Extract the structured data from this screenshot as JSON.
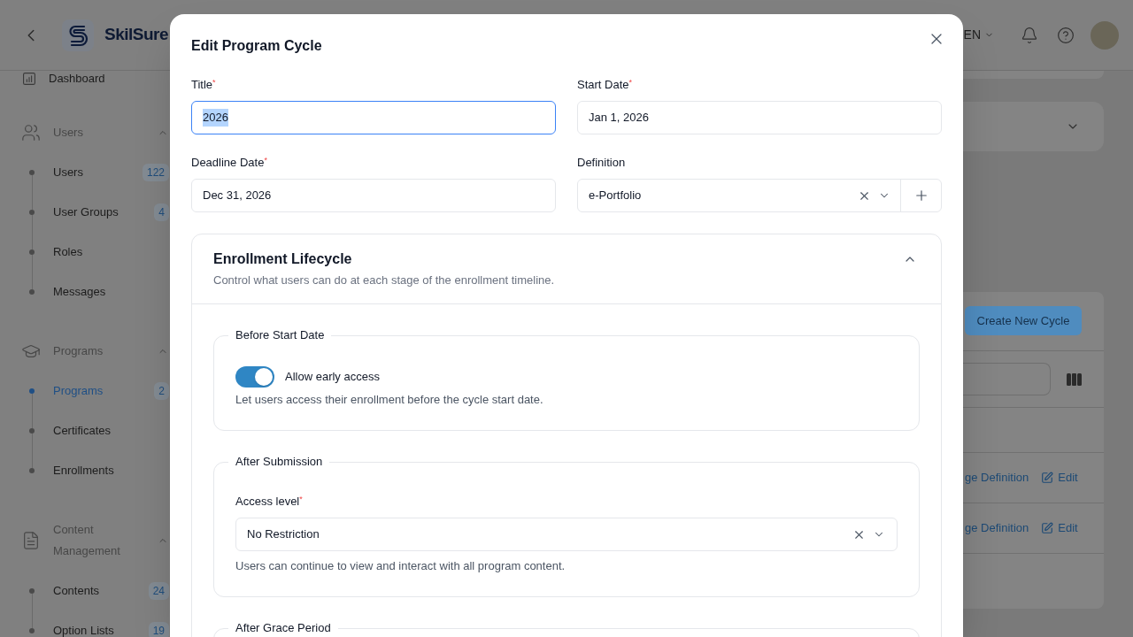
{
  "header": {
    "logo_text": "SkilSure",
    "language": "EN"
  },
  "sidebar": {
    "items": [
      {
        "kind": "link",
        "label": "Dashboard",
        "selected": false
      },
      {
        "kind": "group",
        "label": "Users",
        "expanded": true,
        "children": [
          {
            "label": "Users",
            "count": "122",
            "selected": false
          },
          {
            "label": "User Groups",
            "count": "4",
            "selected": false
          },
          {
            "label": "Roles",
            "selected": false
          },
          {
            "label": "Messages",
            "selected": false
          }
        ]
      },
      {
        "kind": "group",
        "label": "Programs",
        "expanded": true,
        "children": [
          {
            "label": "Programs",
            "count": "2",
            "selected": true
          },
          {
            "label": "Certificates",
            "selected": false
          },
          {
            "label": "Enrollments",
            "selected": false
          }
        ]
      },
      {
        "kind": "group",
        "label": "Content Management",
        "expanded": true,
        "children": [
          {
            "label": "Contents",
            "count": "24",
            "selected": false
          },
          {
            "label": "Option Lists",
            "count": "19",
            "selected": false
          }
        ]
      }
    ]
  },
  "main": {
    "create_button": "Create New Cycle",
    "rows": [
      {
        "action": "ge Definition",
        "edit": "Edit"
      },
      {
        "action": "ge Definition",
        "edit": "Edit"
      }
    ]
  },
  "modal": {
    "title": "Edit Program Cycle",
    "fields": [
      {
        "kind": "text",
        "label": "Title$^{*}$",
        "value": "2026",
        "focused": true
      },
      {
        "kind": "text",
        "label": "Start Date$^{*}$",
        "value": "Jan 1, 2026",
        "focused": false
      },
      {
        "kind": "text",
        "label": "Deadline Date$^{*}$",
        "value": "Dec 31, 2026",
        "focused": false
      },
      {
        "kind": "select",
        "label": "Definition",
        "value": "e-Portfolio",
        "focused": false
      }
    ],
    "lifecycle": {
      "title": "Enrollment Lifecycle",
      "subtitle": "Control what users can do at each stage of the enrollment timeline.",
      "expanded": true,
      "sections": [
        {
          "legend": "Before Start Date",
          "kind": "toggle",
          "label": "Allow early access",
          "on": true,
          "description": "Let users access their enrollment before the cycle start date."
        },
        {
          "legend": "After Submission",
          "kind": "select",
          "label": "Access level$^{*}$",
          "value": "No Restriction",
          "description": "Users can continue to view and interact with all program content."
        },
        {
          "legend": "After Grace Period"
        }
      ]
    }
  }
}
